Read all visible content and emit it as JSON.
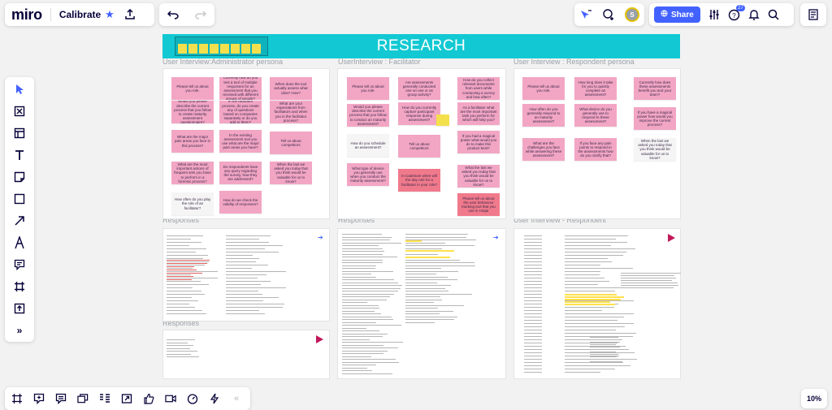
{
  "app": {
    "logo": "miro",
    "board_name": "Calibrate"
  },
  "share": {
    "label": "Share"
  },
  "notifications": {
    "count": "27"
  },
  "avatar": {
    "initial": "S"
  },
  "zoom": {
    "level": "10%"
  },
  "left_tools": [
    "select-tool",
    "frame-tool",
    "template-tool",
    "text-tool",
    "sticky-note-tool",
    "shape-tool",
    "arrow-tool",
    "pen-tool",
    "comment-tool",
    "crop-tool",
    "upload-tool",
    "more-tools"
  ],
  "bottom_tools": [
    "frames",
    "comments",
    "notes",
    "cards",
    "kanban",
    "screen-share",
    "reactions",
    "video",
    "timer",
    "activity"
  ],
  "canvas": {
    "banner": "RESEARCH",
    "frames": [
      {
        "title": "User Interview:Administrator persona"
      },
      {
        "title": "UserInterview : Facilitator"
      },
      {
        "title": "User Interview : Respondent persona"
      },
      {
        "title": "Responses"
      },
      {
        "title": "Responses"
      },
      {
        "title": "User Interview - Respondent"
      },
      {
        "title": "Responses"
      }
    ],
    "admin_stickies": [
      "Please tell us about you role.",
      "Currently how do you test a tool of multiple responses for an assessment that you received with different groups of people?",
      "When does the tool actually assess what idea? How?",
      "Would you please describe the current process that you follow to create maturity assessment questionnaire?",
      "In the facilitator process, do you create any of questions based on companies separately or do you add to them?",
      "What are your expectations from facilitators and when you in the facilitator process?",
      "What are the major pain areas you face in this process?",
      "In the existing assessment tool you use what are the major pain areas you have?",
      "Tell us about competitors",
      "What are the most important actions of frequent sets you have to perform in a forensic process?",
      "Do respondents have any query regarding the survey, how they are addressed?",
      "When the last we asked you today that you think would be valuable for us to know?",
      "How often do you play the role of an facilitator?",
      "How do we check the validity of responses?"
    ],
    "facil_stickies": [
      "Please tell us about you role.",
      "Are assessments generally conducted one on one or as group activity?",
      "How do you collect relevant documents from users while conducting a survey and how often?",
      "Would you please describe the current process that you follow to conduct an maturity assessment?",
      "How do you currently capture participant response during assessment?",
      "As a facilitator what are the most important task you perform for which will help you?",
      "How do you schedule an assessment?",
      "Tell us about competitors",
      "If you had a magical power what would you do to make this product best?",
      "What type of device you generally use when you conduct the maturity assessment?",
      "In Cadmium when will the day role for a facilitator in your role?",
      "What the last we asked you today that you think would be valuable for us to know?",
      "Please tell us about the user behaviour tracking tool that you use in Hotjar"
    ],
    "resp_stickies": [
      "Please tell us about you role.",
      "How long does it take for you to quickly complete an assessment?",
      "Currently how does these assessments benefit you and your team?",
      "How often do you generally respond to an maturity assessment?",
      "What device do you generally use to respond to these assessment?",
      "If you have a magical power how would you improve the current process?",
      "What are the challenges you face while answering these assessment?",
      "If you face any pain points to respond to the assessments how do you clarify that?",
      "When the last we asked you today that you think would be valuable for us to know?"
    ],
    "doc_side_labels": [
      "Name",
      "Role",
      "Responsibilities",
      "Pain Points",
      "Challenges in Survey",
      "Goals",
      "Needs"
    ]
  },
  "colors": {
    "accent": "#4262ff",
    "banner": "#12c9d3",
    "sticky_pink": "#f2a6c4",
    "sticky_red": "#f07a8c",
    "sticky_yellow": "#f4e04d",
    "sticky_white": "#f5f5f5"
  }
}
